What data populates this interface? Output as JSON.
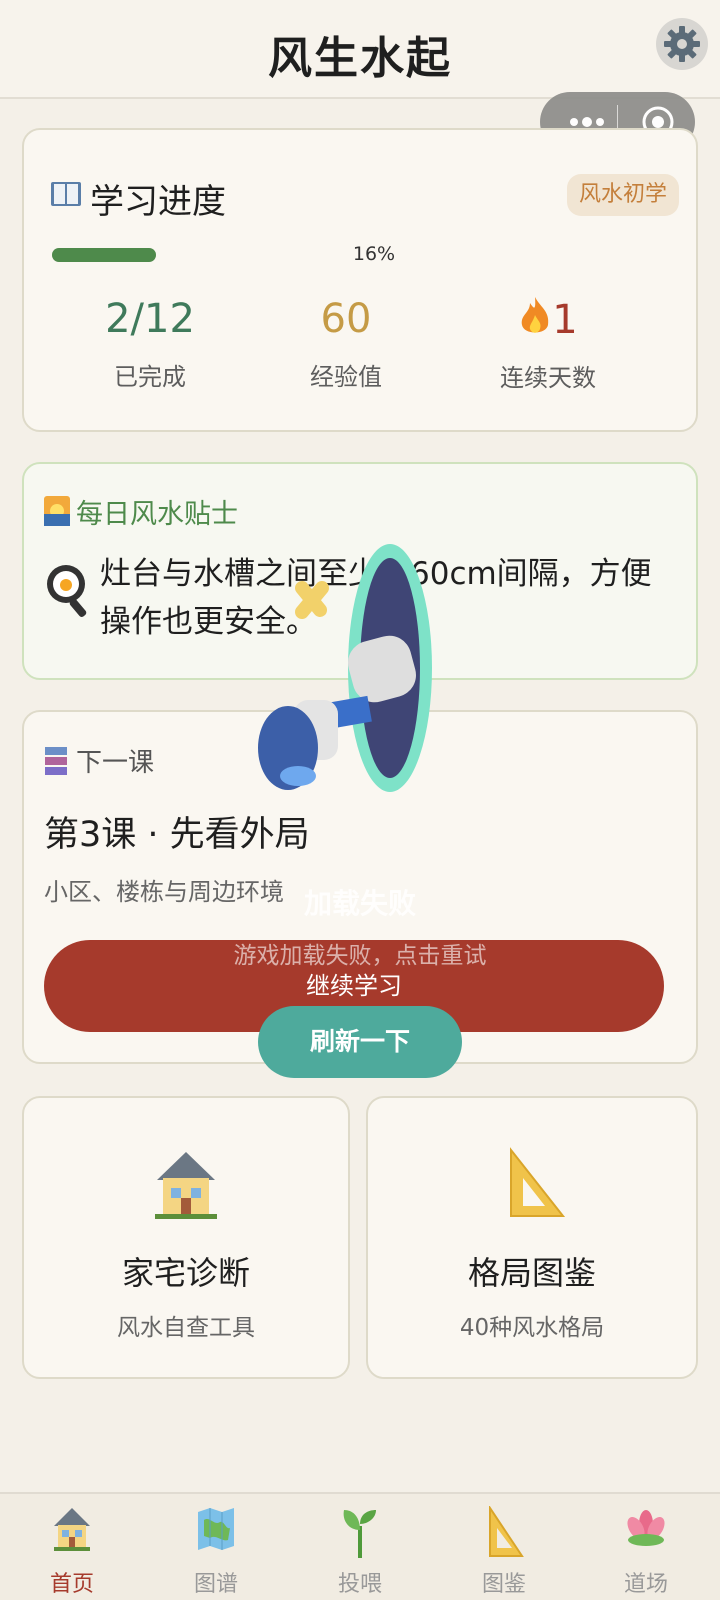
{
  "header": {
    "title": "风生水起"
  },
  "progress": {
    "title": "学习进度",
    "badge": "风水初学",
    "percent_label": "16%",
    "percent_value": 16,
    "stats": [
      {
        "value": "2/12",
        "label": "已完成",
        "color": "#3f7a5b"
      },
      {
        "value": "60",
        "label": "经验值",
        "color": "#c59b46"
      },
      {
        "value": "1",
        "label": "连续天数",
        "color": "#a63a2c"
      }
    ]
  },
  "tip": {
    "title": "每日风水贴士",
    "text": "灶台与水槽之间至少留60cm间隔，方便操作也更安全。"
  },
  "lesson": {
    "head": "下一课",
    "title": "第3课 · 先看外局",
    "subtitle": "小区、楼栋与周边环境",
    "button": "继续学习"
  },
  "tools": [
    {
      "name": "家宅诊断",
      "desc": "风水自查工具"
    },
    {
      "name": "格局图鉴",
      "desc": "40种风水格局"
    }
  ],
  "overlay": {
    "title": "加载失败",
    "desc": "游戏加载失败，点击重试",
    "button": "刷新一下"
  },
  "tabs": [
    {
      "label": "首页",
      "icon": "house-icon",
      "active": true
    },
    {
      "label": "图谱",
      "icon": "map-icon",
      "active": false
    },
    {
      "label": "投喂",
      "icon": "sprout-icon",
      "active": false
    },
    {
      "label": "图鉴",
      "icon": "triangle-ruler-icon",
      "active": false
    },
    {
      "label": "道场",
      "icon": "lotus-icon",
      "active": false
    }
  ]
}
